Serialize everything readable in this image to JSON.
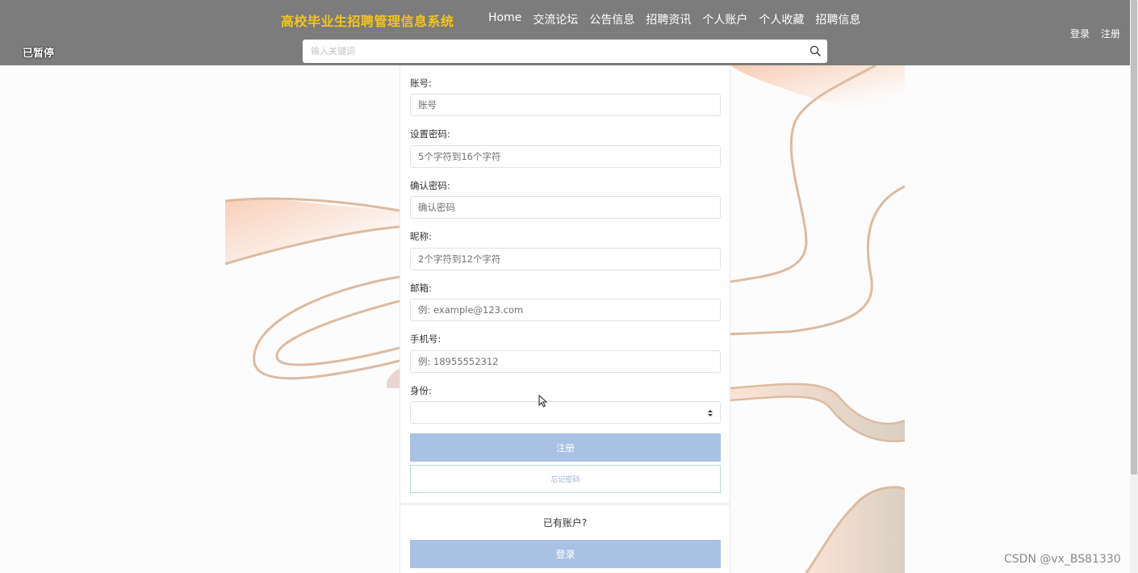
{
  "header": {
    "title": "高校毕业生招聘管理信息系统",
    "nav": [
      "Home",
      "交流论坛",
      "公告信息",
      "招聘资讯",
      "个人账户",
      "个人收藏",
      "招聘信息"
    ],
    "login_link": "登录",
    "register_link": "注册",
    "paused_label": "已暂停",
    "search": {
      "placeholder": "输入关键词",
      "value": "",
      "icon": "search-icon"
    }
  },
  "form": {
    "fields": [
      {
        "label": "账号:",
        "placeholder": "账号"
      },
      {
        "label": "设置密码:",
        "placeholder": "5个字符到16个字符"
      },
      {
        "label": "确认密码:",
        "placeholder": "确认密码"
      },
      {
        "label": "昵称:",
        "placeholder": "2个字符到12个字符"
      },
      {
        "label": "邮箱:",
        "placeholder": "例: example@123.com"
      },
      {
        "label": "手机号:",
        "placeholder": "例: 18955552312"
      }
    ],
    "identity": {
      "label": "身份:",
      "selected": ""
    },
    "register_button": "注册",
    "forgot_button": "忘记密码"
  },
  "login_section": {
    "prompt": "已有账户?",
    "login_button": "登录"
  },
  "watermark": "CSDN @vx_BS81330",
  "colors": {
    "header_bg": "#7c7c7c",
    "title": "#f3c41a",
    "primary_button": "#a9c1e3",
    "forgot_border": "#b6dccf"
  }
}
